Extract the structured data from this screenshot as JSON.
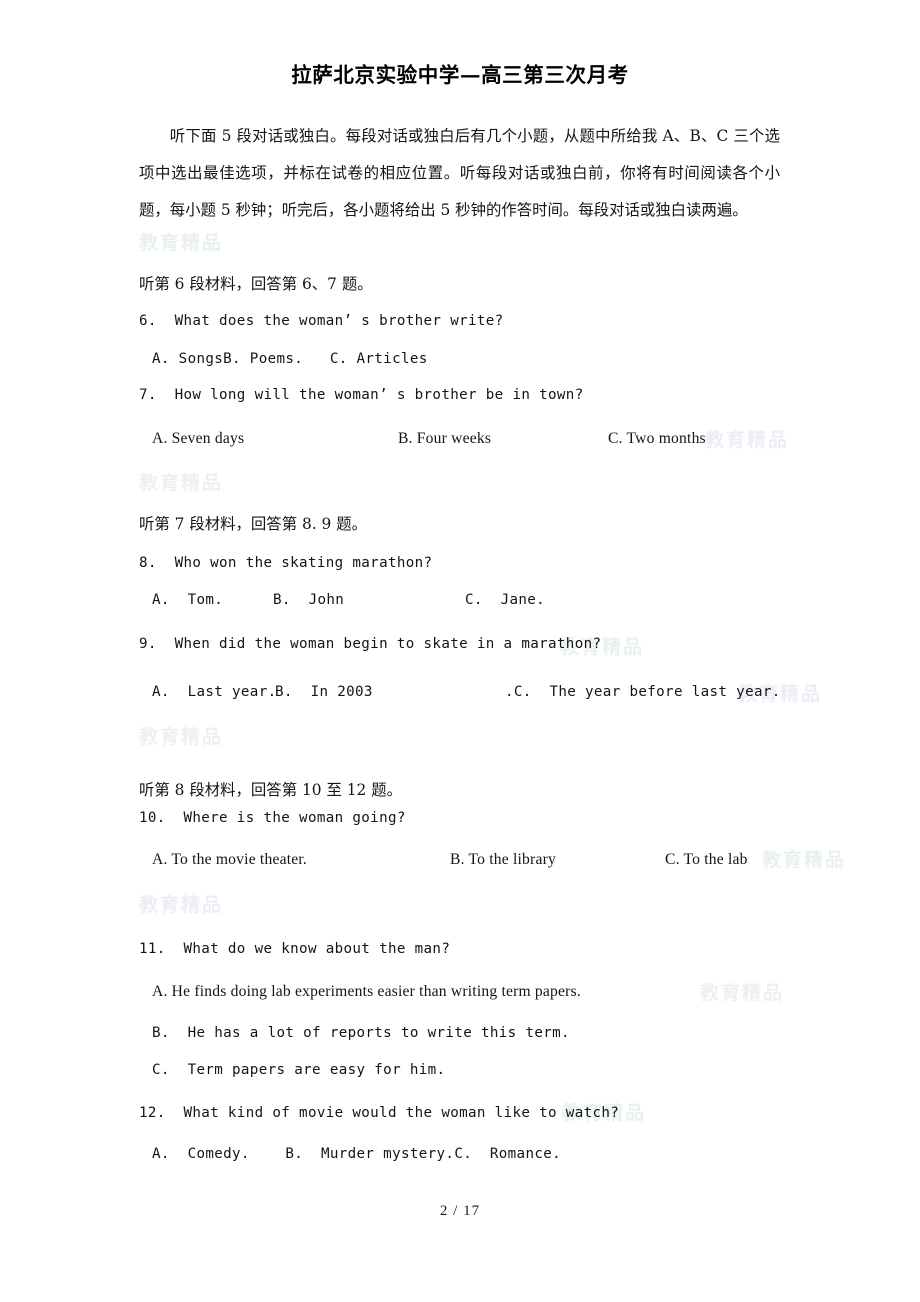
{
  "document": {
    "title": "拉萨北京实验中学—高三第三次月考",
    "footer": "2 / 17",
    "watermark_text": "教育精品"
  },
  "instructions": {
    "text": "听下面 5 段对话或独白。每段对话或独白后有几个小题，从题中所给我 A、B、C 三个选项中选出最佳选项，并标在试卷的相应位置。听每段对话或独白前，你将有时间阅读各个小题，每小题 5 秒钟；听完后，各小题将给出 5 秒钟的作答时间。每段对话或独白读两遍。"
  },
  "sections": [
    {
      "id": "section-6",
      "heading": "听第 6 段材料，回答第 6、7 题。"
    },
    {
      "id": "section-7",
      "heading": "听第 7 段材料，回答第 8. 9 题。"
    },
    {
      "id": "section-8",
      "heading": "听第 8 段材料，回答第 10 至 12 题。"
    }
  ],
  "questions": [
    {
      "number": "6.",
      "stem": "6.  What does the woman’ s brother write?",
      "options_inline": "A. SongsB. Poems.   C. Articles"
    },
    {
      "number": "7.",
      "stem": "7.  How long will the woman’ s brother be in town?",
      "option_a": "A. Seven days",
      "option_b": "B. Four weeks",
      "option_c": "C. Two months"
    },
    {
      "number": "8.",
      "stem": "8.  Who won the skating marathon?",
      "option_a": "A.  Tom.",
      "option_b": "B.  John",
      "option_c": "C.  Jane."
    },
    {
      "number": "9.",
      "stem": "9.  When did the woman begin to skate in a marathon?",
      "option_a": "A.  Last year.",
      "option_b": "B.  In 2003",
      "option_c": ".C.  The year before last year."
    },
    {
      "number": "10.",
      "stem": "10.  Where is the woman going?",
      "option_a": "A. To the movie theater.",
      "option_b": "B. To the library",
      "option_c": "C. To the lab"
    },
    {
      "number": "11.",
      "stem": "11.  What do we know about the man?",
      "option_a": "A. He finds doing lab experiments easier than writing term papers.",
      "option_b": "B.  He has a lot of reports to write this term.",
      "option_c": "C.  Term papers are easy for him."
    },
    {
      "number": "12.",
      "stem": "12.  What kind of movie would the woman like to watch?",
      "options_inline": "A.  Comedy.    B.  Murder mystery.C.  Romance."
    }
  ]
}
